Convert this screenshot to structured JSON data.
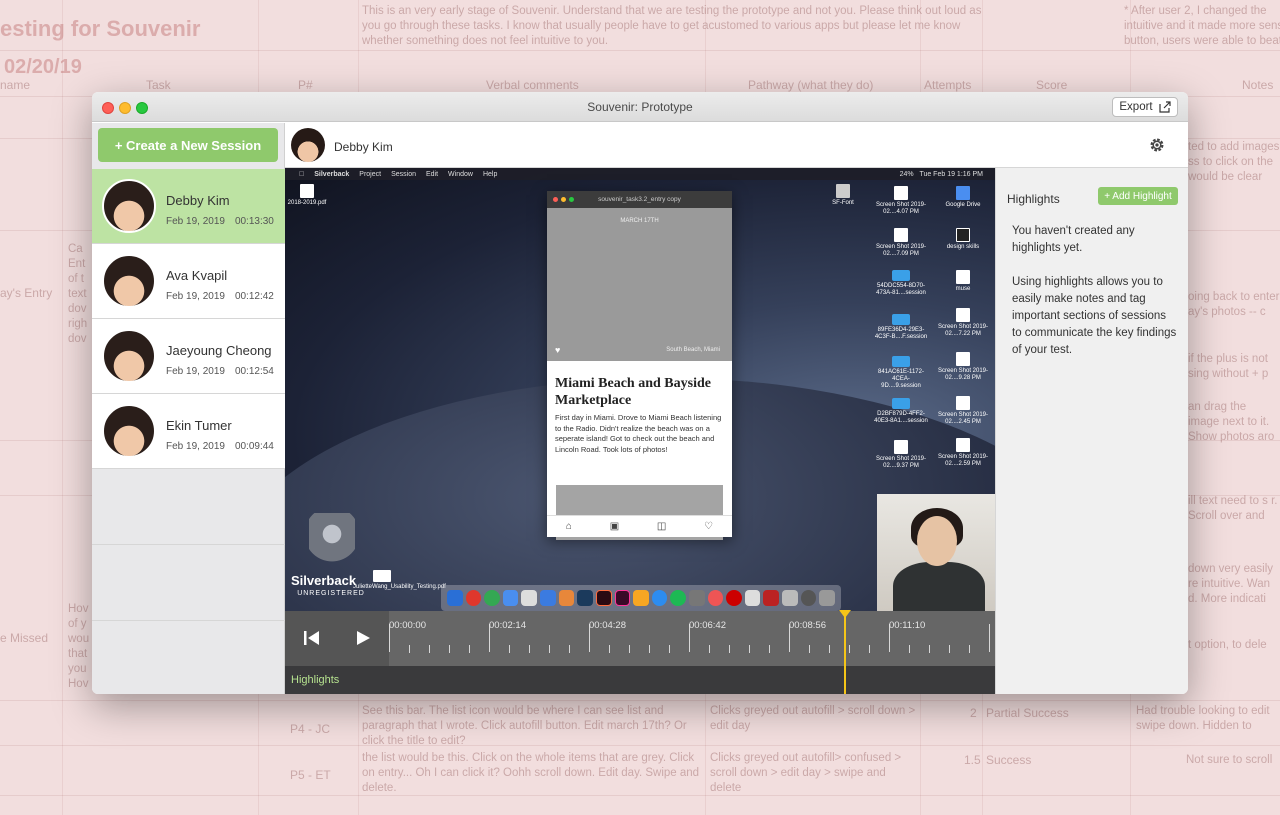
{
  "background": {
    "title": "esting for Souvenir",
    "date": "02/20/19",
    "headers": [
      "name",
      "Task",
      "P#",
      "Verbal comments",
      "Pathway (what they do)",
      "Attempts",
      "Score",
      "Notes"
    ],
    "intro": "This is an very early stage of Souvenir. Understand that we are testing the prototype and not you. Please think out loud as you go through these tasks. I know that usually people have to get acustomed to various apps but please let me know whether something does not feel intuitive to you.",
    "note_right": "* After user 2, I changed the intuitive and it made more sense button, users were able to beat",
    "row_labels": [
      "ay's Entry",
      "e Missed"
    ],
    "rows": [
      {
        "p": "P4 - JC",
        "comment": "See this bar. The list icon would be where I can see list and paragraph that I wrote. Click autofill button. Edit march 17th? Or click the title to edit?",
        "path": "Clicks greyed out autofill > scroll down > edit day",
        "attempts": "2",
        "score": "Partial Success",
        "notes": "Had trouble looking to edit swipe down. Hidden to"
      },
      {
        "p": "P5 - ET",
        "comment": "the list would be this. Click on the whole items that are grey. Click on entry... Oh I can click it? Oohh scroll down. Edit day. Swipe and delete.",
        "path": "Clicks greyed out autofill> confused > scroll down > edit day > swipe and delete",
        "attempts": "1.5",
        "score": "Success",
        "notes": "Not sure to scroll"
      }
    ],
    "right_notes": [
      "ted to add images ss to click on the would be clear",
      "oing back to enter ay's photos -- c",
      "if the plus is not sing without + p",
      "an drag the image next to it. Show photos aro",
      "ill text need to s r. Scroll over and",
      "down very easily re intuitive. Wan d. More indicati",
      "t option, to dele"
    ],
    "left_fragments": [
      "Ca",
      "Ent",
      "of t",
      "text",
      "dov",
      "righ",
      "dov",
      "Hov",
      "of y",
      "wou",
      "that",
      "you",
      "Hov"
    ]
  },
  "window": {
    "title": "Souvenir: Prototype",
    "export_label": "Export"
  },
  "sidebar": {
    "create_label": "+ Create a New Session",
    "sessions": [
      {
        "name": "Debby Kim",
        "date": "Feb 19, 2019",
        "duration": "00:13:30"
      },
      {
        "name": "Ava Kvapil",
        "date": "Feb 19, 2019",
        "duration": "00:12:42"
      },
      {
        "name": "Jaeyoung Cheong",
        "date": "Feb 19, 2019",
        "duration": "00:12:54"
      },
      {
        "name": "Ekin Tumer",
        "date": "Feb 19, 2019",
        "duration": "00:09:44"
      }
    ]
  },
  "header": {
    "participant_name": "Debby Kim"
  },
  "recording": {
    "menubar": {
      "items": [
        "Silverback",
        "Project",
        "Session",
        "Edit",
        "Window",
        "Help"
      ],
      "clock": "Tue Feb 19  1:16 PM",
      "battery": "24%"
    },
    "desktop_files": [
      "2018-2019.pdf",
      "SF-Font",
      "Screen Shot 2019-02....4.07 PM",
      "Google Drive",
      "Screen Shot 2019-02....7.09 PM",
      "design skills",
      "54DDC554-8D70-473A-81....session",
      "muse",
      "89FE36D4-29E3-4C3F-B....F.session",
      "Screen Shot 2019-02....7.22 PM",
      "841AC61E-1172-4CEA-9D....9.session",
      "Screen Shot 2019-02....9.28 PM",
      "D2BF879D-4FF2-40E3-8A1....session",
      "Screen Shot 2019-02....2.45 PM",
      "Screen Shot 2019-02....9.37 PM",
      "Screen Shot 2019-02....2.59 PM",
      "JulietteWang_Usability_Testing.pdf"
    ],
    "phone": {
      "window_title": "souvenir_task3.2_entry copy",
      "photo_date": "MARCH 17TH",
      "photo_location": "South Beach, Miami",
      "entry_title": "Miami Beach and Bayside Marketplace",
      "entry_body": "First day in Miami. Drove to Miami Beach listening to the Radio. Didn't realize the beach was on a seperate island! Got to check out the beach and Lincoln Road. Took lots of photos!"
    },
    "silverback": {
      "brand": "Silverback",
      "status": "UNREGISTERED"
    }
  },
  "timeline": {
    "labels": [
      "00:00:00",
      "00:02:14",
      "00:04:28",
      "00:06:42",
      "00:08:56",
      "00:11:10"
    ],
    "highlights_label": "Highlights"
  },
  "highlights": {
    "title": "Highlights",
    "add_label": "+ Add Highlight",
    "empty_text": "You haven't created any highlights yet.",
    "help_text": "Using highlights allows you to easily make notes and tag important sections of sessions to communicate the key findings of your test."
  },
  "colors": {
    "accent_green": "#8fc96c",
    "active_session": "#bde3a3",
    "playhead": "#f5c518"
  }
}
